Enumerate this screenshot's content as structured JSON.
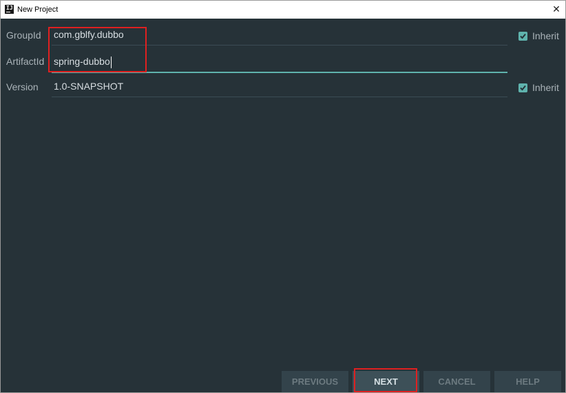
{
  "window": {
    "title": "New Project",
    "close_glyph": "✕"
  },
  "form": {
    "rows": [
      {
        "label": "GroupId",
        "value": "com.gblfy.dubbo",
        "inherit_label": "Inherit",
        "inherit_checked": true
      },
      {
        "label": "ArtifactId",
        "value": "spring-dubbo",
        "focused": true
      },
      {
        "label": "Version",
        "value": "1.0-SNAPSHOT",
        "inherit_label": "Inherit",
        "inherit_checked": true
      }
    ]
  },
  "footer": {
    "previous_label": "PREVIOUS",
    "next_label": "NEXT",
    "cancel_label": "CANCEL",
    "help_label": "HELP"
  },
  "colors": {
    "background": "#263238",
    "accent": "#5fb3ad",
    "label_text": "#aab3b8",
    "highlight": "#e02020"
  },
  "icons": [
    "intellij-app-icon",
    "close-icon",
    "checkmark-icon"
  ]
}
